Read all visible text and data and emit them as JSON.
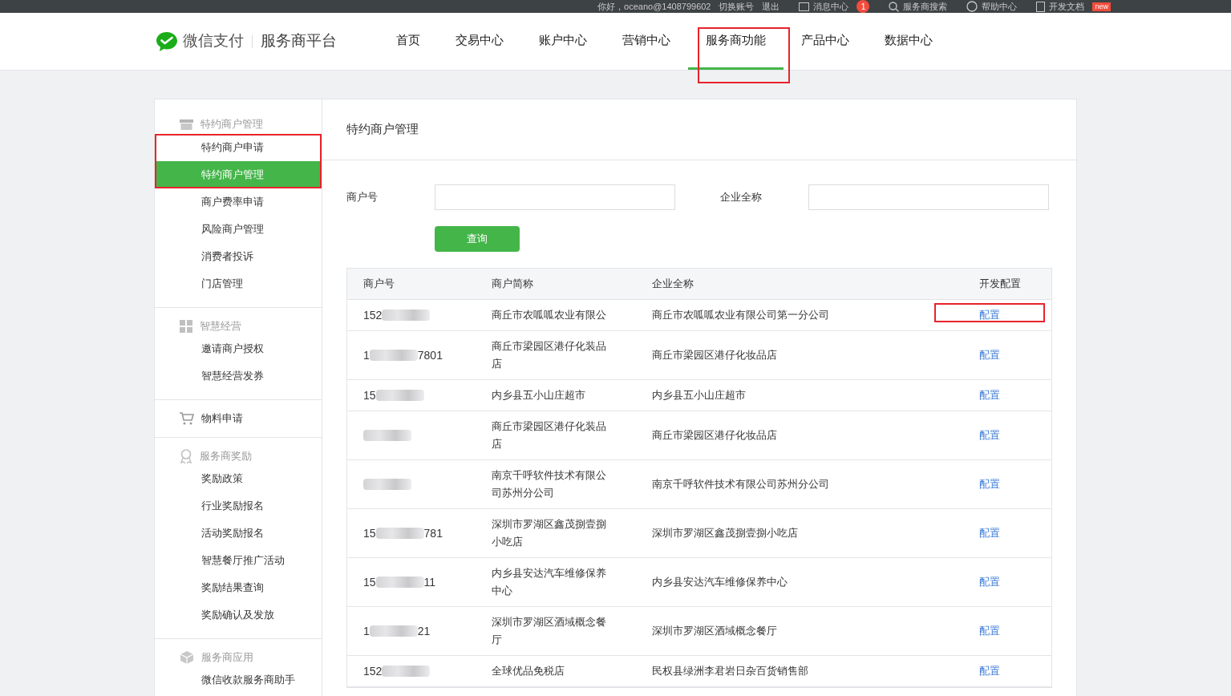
{
  "top_bar": {
    "greeting": "你好，oceano@1408799602",
    "links": [
      {
        "kind": "text",
        "label": "切换账号"
      },
      {
        "kind": "text",
        "label": "退出"
      },
      {
        "kind": "mail",
        "label": "消息中心",
        "badge": "1"
      },
      {
        "kind": "search",
        "label": "服务商搜索"
      },
      {
        "kind": "help",
        "label": "帮助中心"
      },
      {
        "kind": "doc",
        "label": "开发文档",
        "badge": "new"
      }
    ]
  },
  "logo": {
    "brand": "微信支付",
    "product": "服务商平台"
  },
  "nav": [
    {
      "label": "首页",
      "selected": false,
      "highlighted": false
    },
    {
      "label": "交易中心",
      "selected": false,
      "highlighted": false
    },
    {
      "label": "账户中心",
      "selected": false,
      "highlighted": false
    },
    {
      "label": "营销中心",
      "selected": false,
      "highlighted": false
    },
    {
      "label": "服务商功能",
      "selected": true,
      "highlighted": true
    },
    {
      "label": "产品中心",
      "selected": false,
      "highlighted": false
    },
    {
      "label": "数据中心",
      "selected": false,
      "highlighted": false
    }
  ],
  "sidebar": [
    {
      "kind": "store",
      "title": "特约商户管理",
      "items": [
        {
          "label": "特约商户申请",
          "selected": false,
          "highlighted": true
        },
        {
          "label": "特约商户管理",
          "selected": true,
          "highlighted": true
        },
        {
          "label": "商户费率申请",
          "selected": false,
          "highlighted": false
        },
        {
          "label": "风险商户管理",
          "selected": false,
          "highlighted": false
        },
        {
          "label": "消费者投诉",
          "selected": false,
          "highlighted": false
        },
        {
          "label": "门店管理",
          "selected": false,
          "highlighted": false
        }
      ]
    },
    {
      "kind": "grid",
      "title": "智慧经营",
      "items": [
        {
          "label": "邀请商户授权",
          "selected": false,
          "highlighted": false
        },
        {
          "label": "智慧经营发券",
          "selected": false,
          "highlighted": false
        }
      ]
    },
    {
      "kind": "cart",
      "title": "物料申请",
      "link": true
    },
    {
      "kind": "award",
      "title": "服务商奖励",
      "items": [
        {
          "label": "奖励政策",
          "selected": false,
          "highlighted": false
        },
        {
          "label": "行业奖励报名",
          "selected": false,
          "highlighted": false
        },
        {
          "label": "活动奖励报名",
          "selected": false,
          "highlighted": false
        },
        {
          "label": "智慧餐厅推广活动",
          "selected": false,
          "highlighted": false
        },
        {
          "label": "奖励结果查询",
          "selected": false,
          "highlighted": false
        },
        {
          "label": "奖励确认及发放",
          "selected": false,
          "highlighted": false
        }
      ]
    },
    {
      "kind": "box",
      "title": "服务商应用",
      "items": [
        {
          "label": "微信收款服务商助手",
          "selected": false,
          "highlighted": false
        }
      ]
    }
  ],
  "page_title": "特约商户管理",
  "form": {
    "fields": [
      {
        "label": "商户号"
      },
      {
        "label": "企业全称"
      }
    ],
    "button": "查询"
  },
  "table": {
    "columns": [
      "商户号",
      "商户简称",
      "企业全称",
      "开发配置"
    ],
    "rows": [
      {
        "id_start": "152",
        "id_end": "",
        "short_name": "商丘市农呱呱农业有限公",
        "full_name": "商丘市农呱呱农业有限公司第一分公司",
        "action": "配置",
        "highlighted": true
      },
      {
        "id_start": "1",
        "id_end": "7801",
        "short_name": "商丘市梁园区港仔化装品店",
        "full_name": "商丘市梁园区港仔化妆品店",
        "action": "配置",
        "highlighted": false
      },
      {
        "id_start": "15",
        "id_end": "",
        "short_name": "内乡县五小山庄超市",
        "full_name": "内乡县五小山庄超市",
        "action": "配置",
        "highlighted": false
      },
      {
        "id_start": "",
        "id_end": "",
        "short_name": "商丘市梁园区港仔化装品店",
        "full_name": "商丘市梁园区港仔化妆品店",
        "action": "配置",
        "highlighted": false
      },
      {
        "id_start": "",
        "id_end": "",
        "short_name": "南京千呼软件技术有限公司苏州分公司",
        "full_name": "南京千呼软件技术有限公司苏州分公司",
        "action": "配置",
        "highlighted": false
      },
      {
        "id_start": "15",
        "id_end": "781",
        "short_name": "深圳市罗湖区鑫茂捌壹捌小吃店",
        "full_name": "深圳市罗湖区鑫茂捌壹捌小吃店",
        "action": "配置",
        "highlighted": false
      },
      {
        "id_start": "15",
        "id_end": "11",
        "short_name": "内乡县安达汽车维修保养中心",
        "full_name": "内乡县安达汽车维修保养中心",
        "action": "配置",
        "highlighted": false
      },
      {
        "id_start": "1",
        "id_end": "21",
        "short_name": "深圳市罗湖区酒域概念餐厅",
        "full_name": "深圳市罗湖区酒域概念餐厅",
        "action": "配置",
        "highlighted": false
      },
      {
        "id_start": "152",
        "id_end": "",
        "short_name": "全球优品免税店",
        "full_name": "民权县绿洲李君岩日杂百货销售部",
        "action": "配置",
        "highlighted": false
      }
    ]
  }
}
